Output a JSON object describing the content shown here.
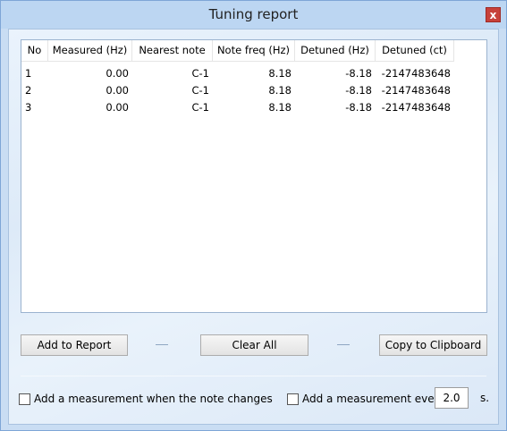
{
  "window": {
    "title": "Tuning report",
    "close_glyph": "x"
  },
  "table": {
    "columns": [
      "No",
      "Measured (Hz)",
      "Nearest note",
      "Note freq (Hz)",
      "Detuned (Hz)",
      "Detuned (ct)"
    ],
    "rows": [
      [
        "1",
        "0.00",
        "C-1",
        "8.18",
        "-8.18",
        "-2147483648"
      ],
      [
        "2",
        "0.00",
        "C-1",
        "8.18",
        "-8.18",
        "-2147483648"
      ],
      [
        "3",
        "0.00",
        "C-1",
        "8.18",
        "-8.18",
        "-2147483648"
      ]
    ]
  },
  "buttons": {
    "add_to_report": "Add to Report",
    "clear_all": "Clear All",
    "copy_to_clipboard": "Copy to Clipboard"
  },
  "options": {
    "on_note_change_label": "Add a measurement when the note changes",
    "on_note_change_checked": false,
    "every_label": "Add a measurement every",
    "every_checked": false,
    "every_value": "2.0",
    "every_unit": "s."
  }
}
